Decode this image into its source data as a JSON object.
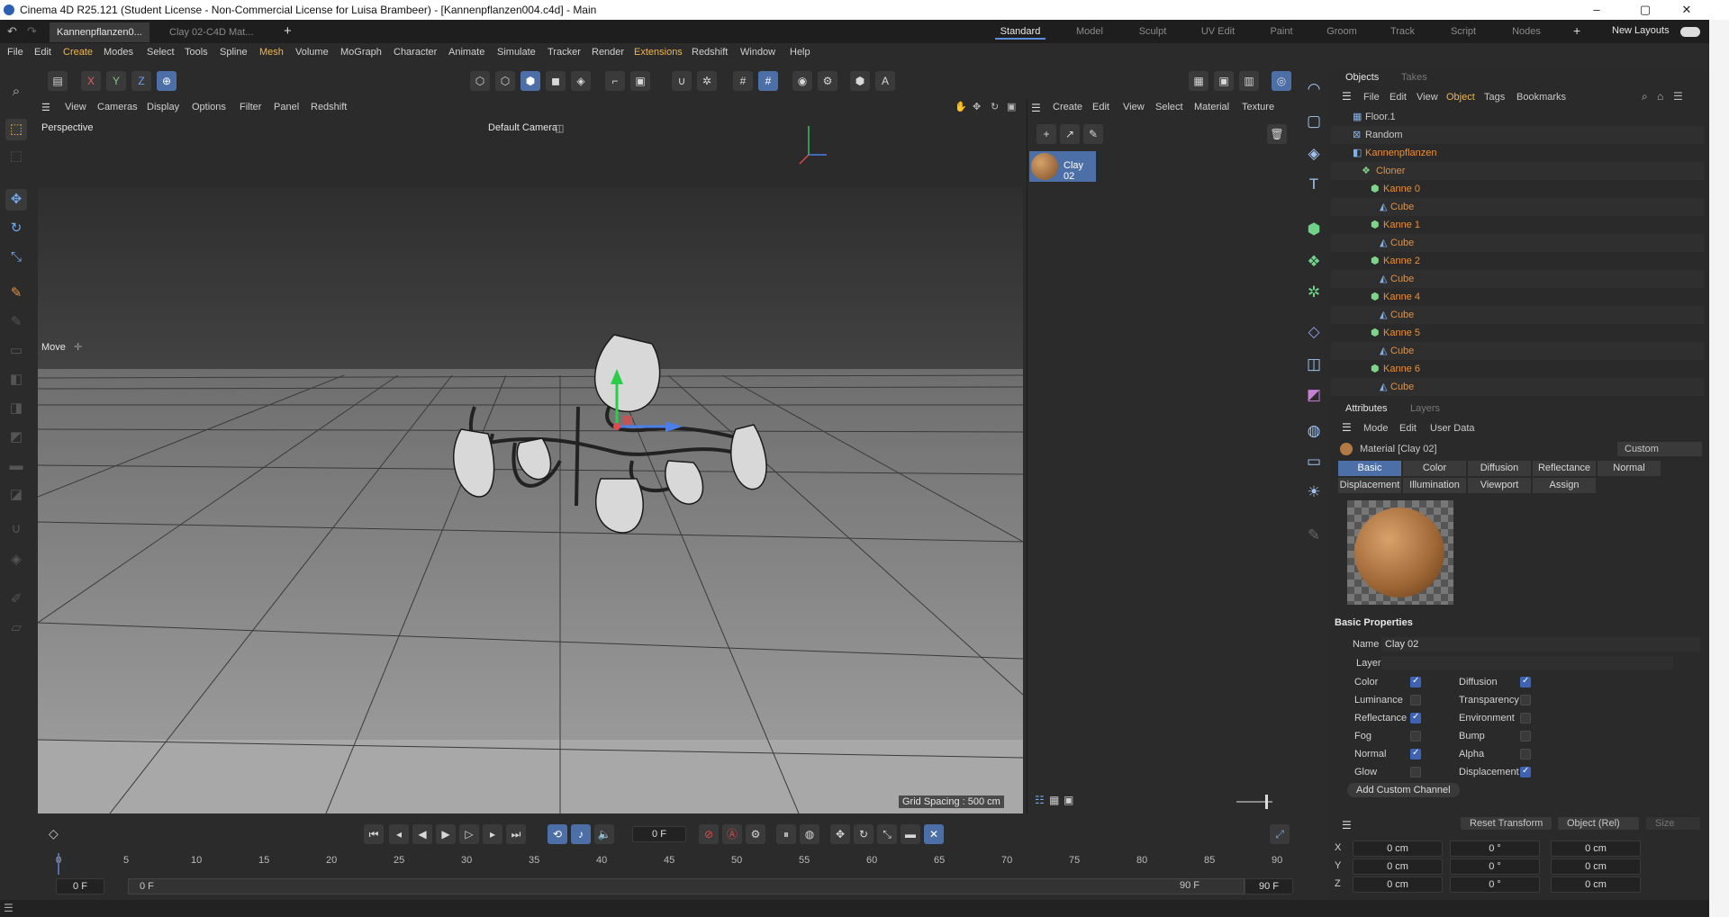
{
  "window": {
    "title": "Cinema 4D R25.121 (Student License - Non-Commercial License for Luisa Brambeer) - [Kannenpflanzen004.c4d] - Main",
    "minimize": "–",
    "maximize": "▢",
    "close": "✕"
  },
  "doc_tabs": [
    "Kannenpflanzen0...",
    "Clay 02-C4D Mat..."
  ],
  "new_tab": "+",
  "layouts": [
    "Standard",
    "Model",
    "Sculpt",
    "UV Edit",
    "Paint",
    "Groom",
    "Track",
    "Script",
    "Nodes"
  ],
  "new_layouts": "New Layouts",
  "menus": [
    "File",
    "Edit",
    "Create",
    "Modes",
    "Select",
    "Tools",
    "Spline",
    "Mesh",
    "Volume",
    "MoGraph",
    "Character",
    "Animate",
    "Simulate",
    "Tracker",
    "Render",
    "Extensions",
    "Redshift",
    "Window",
    "Help"
  ],
  "axes": {
    "x": "X",
    "y": "Y",
    "z": "Z"
  },
  "viewport": {
    "menus": [
      "View",
      "Cameras",
      "Display",
      "Options",
      "Filter",
      "Panel",
      "Redshift"
    ],
    "label": "Perspective",
    "camera": "Default Camera",
    "move_label": "Move",
    "grid_spacing": "Grid Spacing : 500 cm"
  },
  "material_manager": {
    "menus": [
      "Create",
      "Edit",
      "View",
      "Select",
      "Material",
      "Texture"
    ],
    "material_name": "Clay 02"
  },
  "objects_panel": {
    "tabs": [
      "Objects",
      "Takes"
    ],
    "menus": [
      "File",
      "Edit",
      "View",
      "Object",
      "Tags",
      "Bookmarks"
    ],
    "rows": [
      {
        "name": "Floor.1",
        "color": "normal"
      },
      {
        "name": "Random",
        "color": "normal"
      },
      {
        "name": "Kannenpflanzen",
        "color": "orange"
      },
      {
        "name": "Cloner",
        "color": "orange"
      },
      {
        "name": "Kanne 0",
        "color": "orange"
      },
      {
        "name": "Cube",
        "color": "orange"
      },
      {
        "name": "Kanne 1",
        "color": "orange"
      },
      {
        "name": "Cube",
        "color": "orange"
      },
      {
        "name": "Kanne 2",
        "color": "orange"
      },
      {
        "name": "Cube",
        "color": "orange"
      },
      {
        "name": "Kanne 4",
        "color": "orange"
      },
      {
        "name": "Cube",
        "color": "orange"
      },
      {
        "name": "Kanne 5",
        "color": "orange"
      },
      {
        "name": "Cube",
        "color": "orange"
      },
      {
        "name": "Kanne 6",
        "color": "orange"
      },
      {
        "name": "Cube",
        "color": "orange"
      }
    ]
  },
  "attributes": {
    "tabs": [
      "Attributes",
      "Layers"
    ],
    "menus": [
      "Mode",
      "Edit",
      "User Data"
    ],
    "title": "Material [Clay 02]",
    "preset": "Custom",
    "channel_tabs_row1": [
      "Basic",
      "Color",
      "Diffusion",
      "Reflectance",
      "Normal"
    ],
    "channel_tabs_row2": [
      "Displacement",
      "Illumination",
      "Viewport",
      "Assign"
    ],
    "section": "Basic Properties",
    "name_label": "Name",
    "name_value": "Clay 02",
    "layer_label": "Layer",
    "channels_left": [
      {
        "label": "Color",
        "on": true
      },
      {
        "label": "Luminance",
        "on": false
      },
      {
        "label": "Reflectance",
        "on": true
      },
      {
        "label": "Fog",
        "on": false
      },
      {
        "label": "Normal",
        "on": true
      },
      {
        "label": "Glow",
        "on": false
      }
    ],
    "channels_right": [
      {
        "label": "Diffusion",
        "on": true
      },
      {
        "label": "Transparency",
        "on": false
      },
      {
        "label": "Environment",
        "on": false
      },
      {
        "label": "Bump",
        "on": false
      },
      {
        "label": "Alpha",
        "on": false
      },
      {
        "label": "Displacement",
        "on": true
      }
    ],
    "add_channel": "Add Custom Channel"
  },
  "coords": {
    "reset": "Reset Transform",
    "mode": "Object (Rel)",
    "size": "Size",
    "rows": [
      {
        "axis": "X",
        "pos": "0 cm",
        "rot": "0 °",
        "size": "0 cm"
      },
      {
        "axis": "Y",
        "pos": "0 cm",
        "rot": "0 °",
        "size": "0 cm"
      },
      {
        "axis": "Z",
        "pos": "0 cm",
        "rot": "0 °",
        "size": "0 cm"
      }
    ]
  },
  "timeline": {
    "frame": "0 F",
    "ticks": [
      "0",
      "5",
      "10",
      "15",
      "20",
      "25",
      "30",
      "35",
      "40",
      "45",
      "50",
      "55",
      "60",
      "65",
      "70",
      "75",
      "80",
      "85",
      "90"
    ],
    "start": "0 F",
    "start2": "0 F",
    "end": "90 F",
    "end2": "90 F"
  },
  "colors": {
    "accent": "#4d6fa8",
    "orange": "#e8903a",
    "bg": "#2b2b2b"
  }
}
